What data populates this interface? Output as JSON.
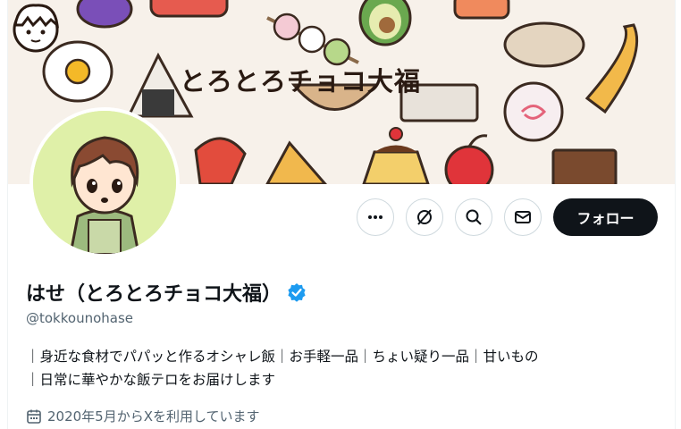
{
  "profile": {
    "banner_title": "とろとろチョコ大福",
    "display_name": "はせ（とろとろチョコ大福）",
    "handle": "@tokkounohase",
    "bio_lines": [
      "｜身近な食材でパパッと作るオシャレ飯｜お手軽一品｜ちょい疑り一品｜甘いもの",
      "｜日常に華やかな飯テロをお届けします"
    ],
    "joined": "2020年5月からXを利用しています",
    "verified": true
  },
  "actions": {
    "more_icon": "more-dots-icon",
    "grok_icon": "grok-slash-icon",
    "search_icon": "search-icon",
    "message_icon": "envelope-icon",
    "follow_label": "フォロー"
  },
  "colors": {
    "verified_blue": "#1d9bf0",
    "follow_bg": "#0f1419",
    "secondary_text": "#536471",
    "avatar_bg": "#dff0a8"
  }
}
